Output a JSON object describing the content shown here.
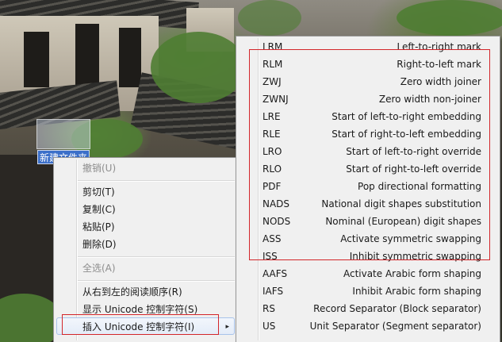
{
  "desktop": {
    "icon_name": "新建文件夹"
  },
  "context_menu": {
    "items": [
      {
        "label": "撤销(U)",
        "disabled": true
      },
      {
        "separator": true
      },
      {
        "label": "剪切(T)"
      },
      {
        "label": "复制(C)"
      },
      {
        "label": "粘贴(P)"
      },
      {
        "label": "删除(D)"
      },
      {
        "separator": true
      },
      {
        "label": "全选(A)",
        "disabled": true
      },
      {
        "separator": true
      },
      {
        "label": "从右到左的阅读顺序(R)"
      },
      {
        "label": "显示 Unicode 控制字符(S)"
      },
      {
        "label": "插入 Unicode 控制字符(I)",
        "submenu": true,
        "highlighted": true
      }
    ],
    "submenu_arrow": "▸"
  },
  "unicode_submenu": {
    "items": [
      {
        "code": "LRM",
        "description": "Left-to-right mark"
      },
      {
        "code": "RLM",
        "description": "Right-to-left mark"
      },
      {
        "code": "ZWJ",
        "description": "Zero width joiner"
      },
      {
        "code": "ZWNJ",
        "description": "Zero width non-joiner"
      },
      {
        "code": "LRE",
        "description": "Start of left-to-right embedding"
      },
      {
        "code": "RLE",
        "description": "Start of right-to-left embedding"
      },
      {
        "code": "LRO",
        "description": "Start of left-to-right override"
      },
      {
        "code": "RLO",
        "description": "Start of right-to-left override"
      },
      {
        "code": "PDF",
        "description": "Pop directional formatting"
      },
      {
        "code": "NADS",
        "description": "National digit shapes substitution"
      },
      {
        "code": "NODS",
        "description": "Nominal (European) digit shapes"
      },
      {
        "code": "ASS",
        "description": "Activate symmetric swapping"
      },
      {
        "code": "ISS",
        "description": "Inhibit symmetric swapping"
      },
      {
        "code": "AAFS",
        "description": "Activate Arabic form shaping"
      },
      {
        "code": "IAFS",
        "description": "Inhibit Arabic form shaping"
      },
      {
        "code": "RS",
        "description": "Record Separator (Block separator)"
      },
      {
        "code": "US",
        "description": "Unit Separator (Segment separator)"
      }
    ]
  },
  "colors": {
    "annotation": "#d3262a",
    "menu_background": "#f0f0f0",
    "rename_highlight": "#3b6fc9"
  }
}
